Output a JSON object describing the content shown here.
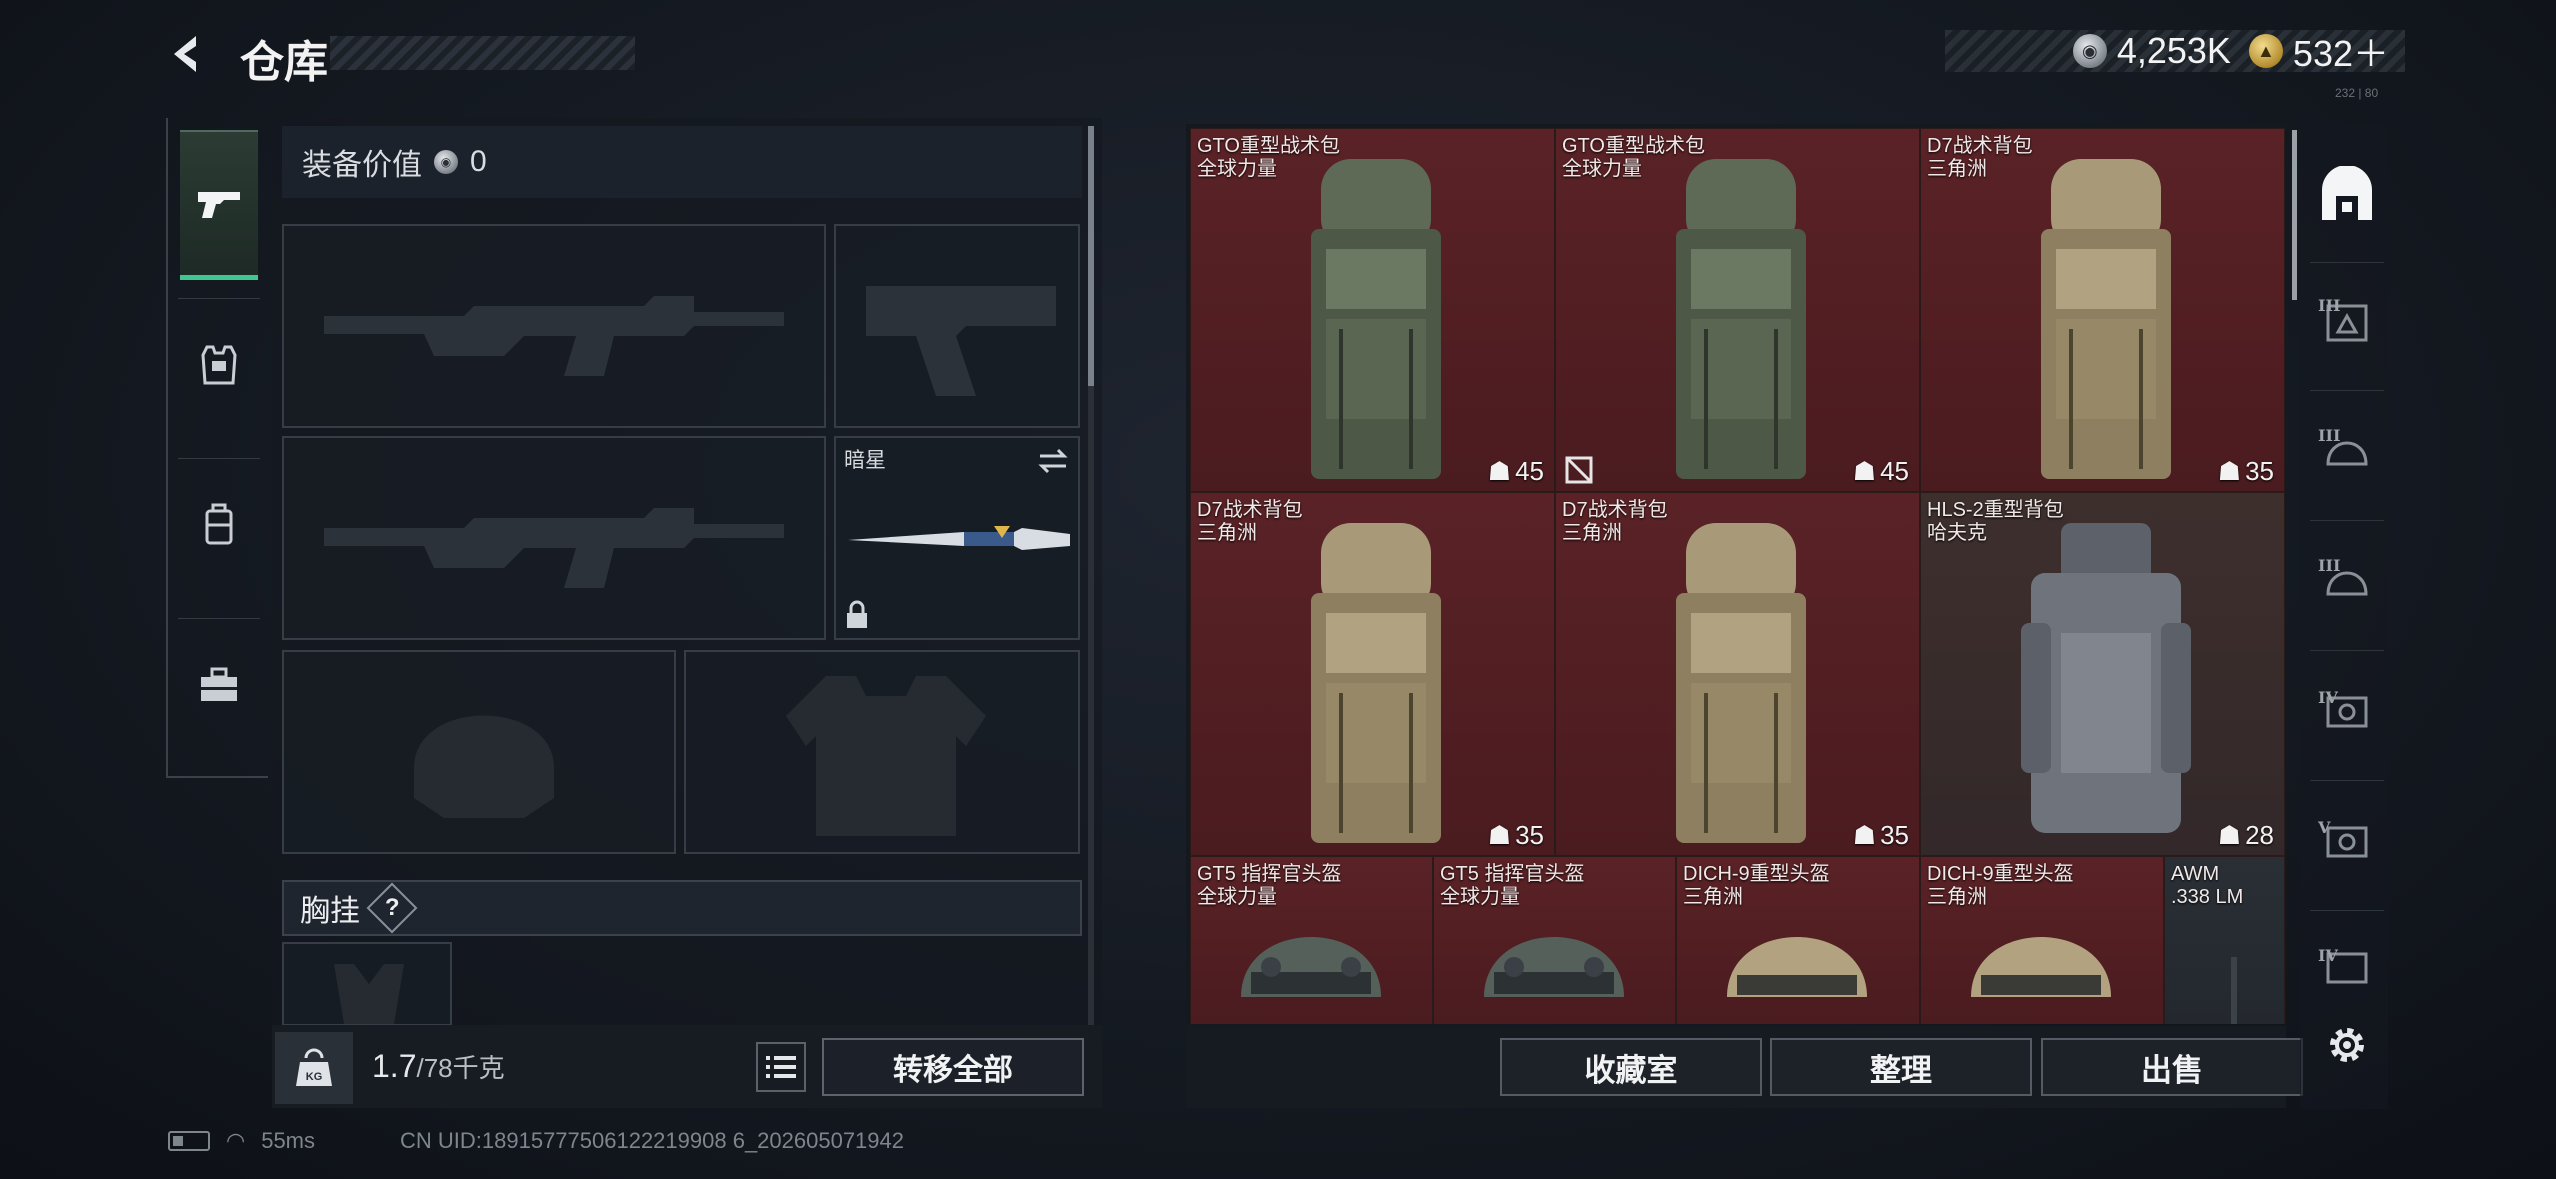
{
  "header": {
    "title": "仓库",
    "currency": [
      {
        "type": "silver",
        "value": "4,253K"
      },
      {
        "type": "gold",
        "value": "532＋"
      }
    ],
    "version": "232 | 80"
  },
  "equipment": {
    "value_label": "装备价值",
    "value_amount": "0",
    "melee_name": "暗星",
    "section_chest": "胸挂",
    "section_help": "?",
    "weight_current": "1.7",
    "weight_max": "/78千克",
    "kg_label": "KG",
    "transfer_all_label": "转移全部"
  },
  "storage": {
    "items": [
      {
        "name": "GTO重型战术包",
        "sub": "全球力量",
        "count": "45",
        "color": "red"
      },
      {
        "name": "GTO重型战术包",
        "sub": "全球力量",
        "count": "45",
        "color": "red"
      },
      {
        "name": "D7战术背包",
        "sub": "三角洲",
        "count": "35",
        "color": "red"
      },
      {
        "name": "D7战术背包",
        "sub": "三角洲",
        "count": "35",
        "color": "red"
      },
      {
        "name": "D7战术背包",
        "sub": "三角洲",
        "count": "35",
        "color": "red"
      },
      {
        "name": "HLS-2重型背包",
        "sub": "哈夫克",
        "count": "28",
        "color": "brown"
      },
      {
        "name": "GT5 指挥官头盔",
        "sub": "全球力量",
        "color": "red"
      },
      {
        "name": "GT5 指挥官头盔",
        "sub": "全球力量",
        "color": "red"
      },
      {
        "name": "DICH-9重型头盔",
        "sub": "三角洲",
        "color": "red"
      },
      {
        "name": "DICH-9重型头盔",
        "sub": "三角洲",
        "color": "red"
      },
      {
        "name": "AWM",
        "sub": ".338 LM",
        "color": "dark"
      }
    ],
    "buttons": {
      "collection": "收藏室",
      "sort": "整理",
      "sell": "出售"
    }
  },
  "filters": {
    "tiers": [
      "III",
      "III",
      "III",
      "IV",
      "V",
      "IV"
    ]
  },
  "status": {
    "ping": "55ms",
    "uid": "CN UID:18915777506122219908 6_202605071942"
  }
}
